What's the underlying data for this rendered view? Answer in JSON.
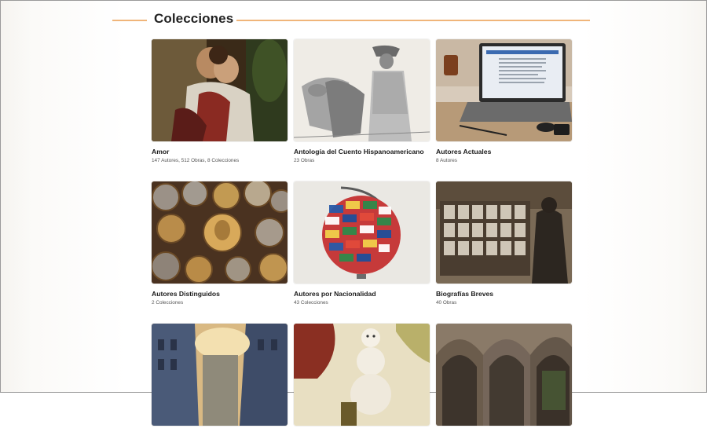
{
  "section": {
    "title": "Colecciones"
  },
  "colors": {
    "accent": "#f0b57a"
  },
  "collections": [
    {
      "title": "Amor",
      "meta": "147 Autores, 512 Obras, 8 Colecciones",
      "image": "romantic-painting-couple"
    },
    {
      "title": "Antología del Cuento Hispanoamericano",
      "meta": "23 Obras",
      "image": "sketch-woman-with-donkeys"
    },
    {
      "title": "Autores Actuales",
      "meta": "8 Autores",
      "image": "laptop-on-desk"
    },
    {
      "title": "Autores Distinguidos",
      "meta": "2 Colecciones",
      "image": "bronze-medallions-portraits"
    },
    {
      "title": "Autores por Nacionalidad",
      "meta": "43 Colecciones",
      "image": "globe-with-flags"
    },
    {
      "title": "Biografías Breves",
      "meta": "40 Obras",
      "image": "man-viewing-portrait-gallery"
    },
    {
      "title": "",
      "meta": "",
      "image": "city-street-painting"
    },
    {
      "title": "",
      "meta": "",
      "image": "snowman-illustration"
    },
    {
      "title": "",
      "meta": "",
      "image": "gothic-cloister-arches"
    }
  ]
}
